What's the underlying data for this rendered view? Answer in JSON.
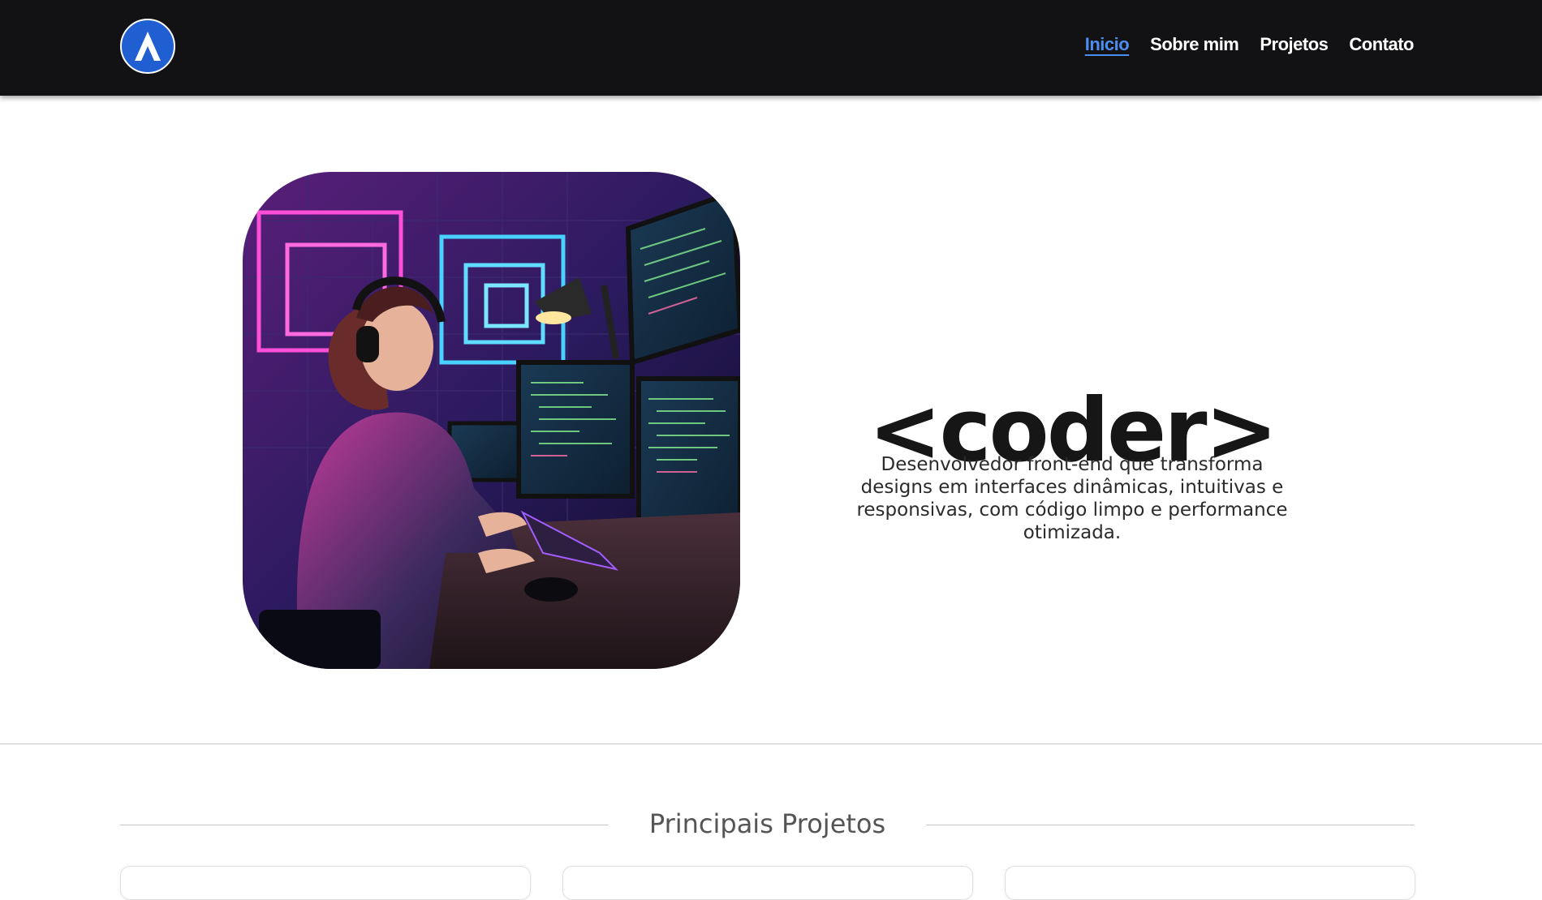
{
  "header": {
    "logo_icon": "triangle-a-logo-icon",
    "nav": [
      {
        "label": "Inicio",
        "active": true
      },
      {
        "label": "Sobre mim",
        "active": false
      },
      {
        "label": "Projetos",
        "active": false
      },
      {
        "label": "Contato",
        "active": false
      }
    ]
  },
  "hero": {
    "image_icon": "coder-workstation-illustration",
    "title": "<coder>",
    "description": "Desenvolvedor front-end que transforma designs em interfaces dinâmicas, intuitivas e responsivas, com código limpo e performance otimizada."
  },
  "projects": {
    "title": "Principais Projetos"
  },
  "colors": {
    "header_bg": "#121214",
    "accent": "#4b8df0",
    "logo_bg": "#1f5fd1"
  }
}
